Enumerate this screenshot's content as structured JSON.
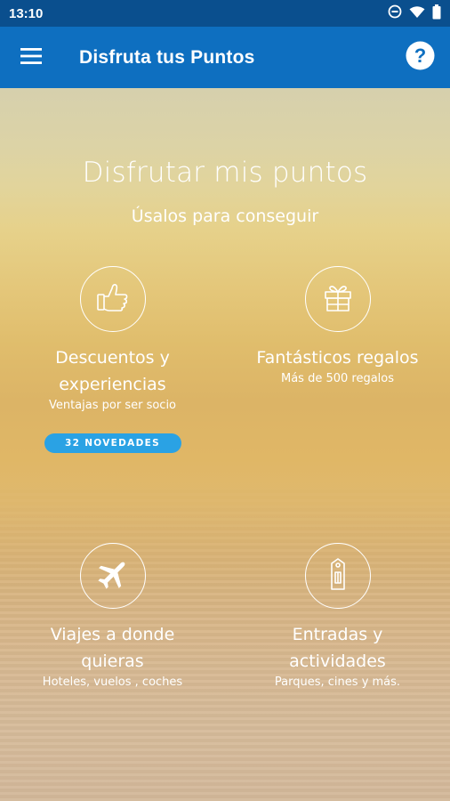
{
  "status_bar": {
    "time": "13:10",
    "icons": [
      "do-not-disturb-icon",
      "wifi-icon",
      "battery-icon"
    ]
  },
  "app_bar": {
    "title": "Disfruta tus Puntos",
    "menu_icon": "hamburger-menu-icon",
    "help_icon": "help-icon",
    "color": "#0e6fc0"
  },
  "hero": {
    "headline": "Disfrutar mis puntos",
    "subhead": "Úsalos para conseguir"
  },
  "tiles": [
    {
      "icon": "thumbs-up-icon",
      "title_line1": "Descuentos y",
      "title_line2": "experiencias",
      "subtitle": "Ventajas por ser socio",
      "badge": "32 NOVEDADES"
    },
    {
      "icon": "gift-icon",
      "title_line1": "Fantásticos regalos",
      "subtitle": "Más de 500 regalos"
    },
    {
      "icon": "airplane-icon",
      "title_line1": "Viajes a donde",
      "title_line2": "quieras",
      "subtitle": "Hoteles, vuelos , coches"
    },
    {
      "icon": "ticket-icon",
      "title_line1": "Entradas y",
      "title_line2": "actividades",
      "subtitle": "Parques, cines y más."
    }
  ],
  "colors": {
    "status_bar": "#0a4f8e",
    "badge": "#2aa2e4"
  }
}
